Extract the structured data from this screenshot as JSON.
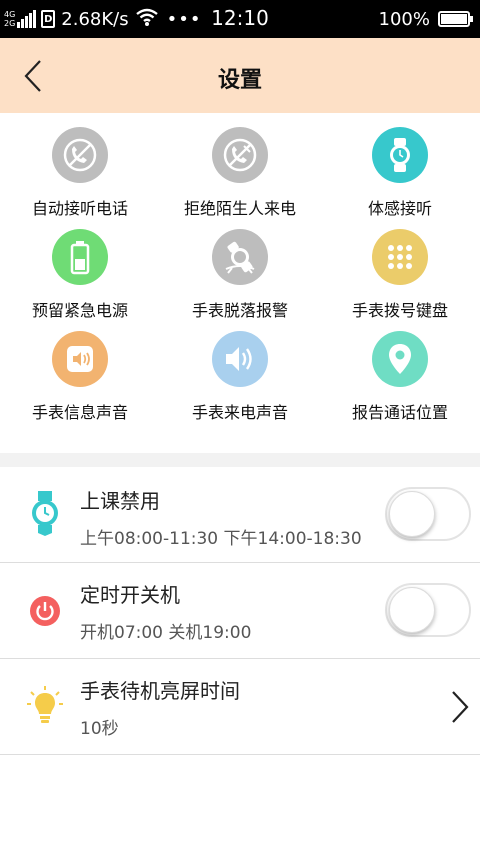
{
  "status_bar": {
    "network_top": "4G",
    "network_bottom": "2G",
    "sim_label": "D",
    "speed": "2.68K/s",
    "more": "•••",
    "time": "12:10",
    "battery": "100%"
  },
  "header": {
    "title": "设置",
    "background_color": "#fde0c6"
  },
  "grid": {
    "items": [
      {
        "label": "自动接听电话",
        "icon": "auto-answer-icon",
        "color": "#bdbdbd"
      },
      {
        "label": "拒绝陌生人来电",
        "icon": "reject-stranger-call-icon",
        "color": "#bdbdbd"
      },
      {
        "label": "体感接听",
        "icon": "watch-motion-answer-icon",
        "color": "#37c8cc"
      },
      {
        "label": "预留紧急电源",
        "icon": "battery-icon",
        "color": "#6fdc75"
      },
      {
        "label": "手表脱落报警",
        "icon": "watch-fall-alarm-icon",
        "color": "#bdbdbd"
      },
      {
        "label": "手表拨号键盘",
        "icon": "keypad-icon",
        "color": "#ebcc6a"
      },
      {
        "label": "手表信息声音",
        "icon": "message-sound-icon",
        "color": "#f2b370"
      },
      {
        "label": "手表来电声音",
        "icon": "call-sound-icon",
        "color": "#a9d0ee"
      },
      {
        "label": "报告通话位置",
        "icon": "location-pin-icon",
        "color": "#6fddc4"
      }
    ]
  },
  "list": {
    "class_disable": {
      "title": "上课禁用",
      "subtitle": "上午08:00-11:30 下午14:00-18:30",
      "icon": "watch-icon",
      "toggle_on": false
    },
    "scheduled_power": {
      "title": "定时开关机",
      "subtitle": "开机07:00 关机19:00",
      "icon": "power-icon",
      "toggle_on": false
    },
    "screen_time": {
      "title": "手表待机亮屏时间",
      "subtitle": "10秒",
      "icon": "bulb-icon"
    }
  }
}
